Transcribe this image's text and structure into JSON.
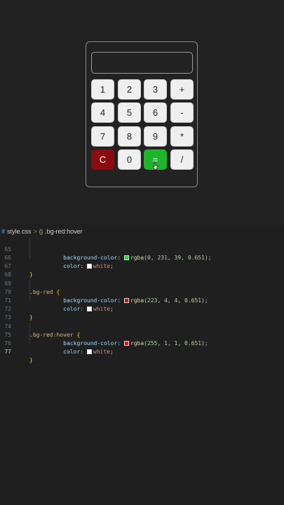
{
  "calculator": {
    "display_value": "",
    "keys": [
      {
        "label": "1",
        "style": "normal"
      },
      {
        "label": "2",
        "style": "normal"
      },
      {
        "label": "3",
        "style": "normal"
      },
      {
        "label": "+",
        "style": "normal"
      },
      {
        "label": "4",
        "style": "normal"
      },
      {
        "label": "5",
        "style": "normal"
      },
      {
        "label": "6",
        "style": "normal"
      },
      {
        "label": "-",
        "style": "normal"
      },
      {
        "label": "7",
        "style": "normal"
      },
      {
        "label": "8",
        "style": "normal"
      },
      {
        "label": "9",
        "style": "normal"
      },
      {
        "label": "*",
        "style": "normal"
      },
      {
        "label": "C",
        "style": "red"
      },
      {
        "label": "0",
        "style": "normal"
      },
      {
        "label": "=",
        "style": "green"
      },
      {
        "label": "/",
        "style": "normal"
      }
    ]
  },
  "breadcrumb": {
    "file_icon": "#",
    "file": "style.css",
    "separator": ">",
    "rule_icon": "{}",
    "rule": ".bg-red:hover"
  },
  "editor": {
    "colors": {
      "green_swatch": "#00e727",
      "red_swatch": "#df0404",
      "hover_swatch": "#ff0101",
      "white_swatch": "#ffffff"
    },
    "lines": [
      {
        "n": "65",
        "t": "    background-color: rgba(0, 231, 39, 0.651);"
      },
      {
        "n": "66",
        "t": "    color: white;"
      },
      {
        "n": "67",
        "t": "}"
      },
      {
        "n": "68",
        "t": ""
      },
      {
        "n": "69",
        "t": ".bg-red {"
      },
      {
        "n": "70",
        "t": "    background-color: rgba(223, 4, 4, 0.651);"
      },
      {
        "n": "71",
        "t": "    color: white;"
      },
      {
        "n": "72",
        "t": "}"
      },
      {
        "n": "73",
        "t": ""
      },
      {
        "n": "74",
        "t": ".bg-red:hover {"
      },
      {
        "n": "75",
        "t": "    background-color: rgba(255, 1, 1, 0.651);"
      },
      {
        "n": "76",
        "t": "    color: white;"
      },
      {
        "n": "77",
        "t": "}"
      }
    ],
    "tokens": {
      "bg_prop": "background-color:",
      "color_prop": "color:",
      "rgba": "rgba",
      "white": "white",
      "sel_bg_red": ".bg-red",
      "sel_bg_red_hover": ".bg-red:hover",
      "l65_args": [
        "0",
        "231",
        "39",
        "0.651"
      ],
      "l70_args": [
        "223",
        "4",
        "4",
        "0.651"
      ],
      "l75_args": [
        "255",
        "1",
        "1",
        "0.651"
      ]
    }
  }
}
